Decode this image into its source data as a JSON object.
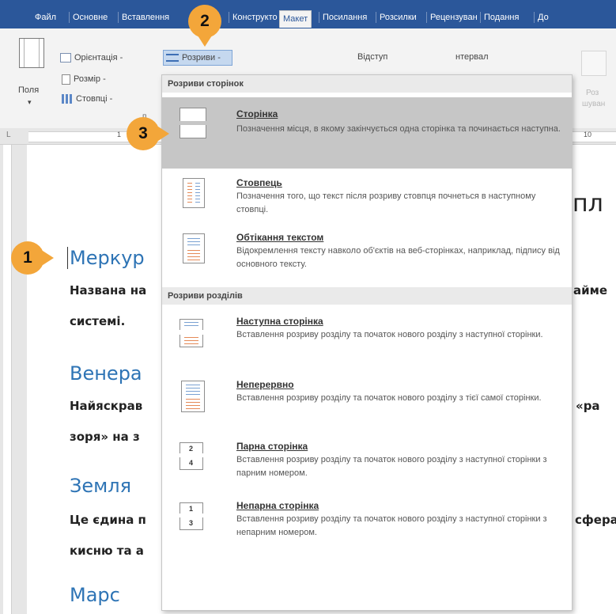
{
  "tabs": [
    "Файл",
    "Основне",
    "Вставлення",
    "Конструкто",
    "Макет",
    "Посилання",
    "Розсилки",
    "Рецензуван",
    "Подання",
    "До"
  ],
  "ribbon": {
    "margins_label": "Поля",
    "orientation_label": "Орієнтація -",
    "size_label": "Розмір -",
    "columns_label": "Стовпці -",
    "breaks_label": "Розриви -",
    "indent_label": "Відступ",
    "spacing_label": "нтервал",
    "group_label": "п",
    "right_faded_1": "Роз",
    "right_faded_2": "шуван"
  },
  "ruler": {
    "left_num": "1",
    "right_num": "10"
  },
  "document": {
    "headings": [
      "Меркур",
      "Венера",
      "Земля",
      "Марс"
    ],
    "title_fragment": "пл",
    "lines": [
      "Названа на",
      "системі.",
      "Найяскрав",
      "зоря» на з",
      "Це єдина п",
      "кисню та а"
    ],
    "right_fragments": [
      "айме",
      "«ра",
      "сфера"
    ]
  },
  "menu": {
    "section1": "Розриви сторінок",
    "section2": "Розриви розділів",
    "items": [
      {
        "title": "Сторінка",
        "desc": "Позначення місця, в якому закінчується одна сторінка та починається наступна."
      },
      {
        "title": "Стовпець",
        "desc": "Позначення того, що текст після розриву стовпця почнеться в наступному стовпці."
      },
      {
        "title": "Обтікання текстом",
        "desc": "Відокремлення тексту навколо об'єктів на веб-сторінках, наприклад, підпису від основного тексту."
      },
      {
        "title": "Наступна сторінка",
        "desc": "Вставлення розриву розділу та початок нового розділу з наступної сторінки."
      },
      {
        "title": "Неперервно",
        "desc": "Вставлення розриву розділу та початок нового розділу з тієї самої сторінки."
      },
      {
        "title": "Парна сторінка",
        "desc": "Вставлення розриву розділу та початок нового розділу з наступної сторінки з парним номером."
      },
      {
        "title": "Непарна сторінка",
        "desc": "Вставлення розриву розділу та початок нового розділу з наступної сторінки з непарним номером."
      }
    ],
    "icon_numbers": {
      "even_top": "2",
      "even_bottom": "4",
      "odd_top": "1",
      "odd_bottom": "3"
    }
  },
  "callouts": [
    "1",
    "2",
    "3"
  ],
  "colors": {
    "ribbon_blue": "#2b579a",
    "heading_blue": "#2e74b5",
    "callout_orange": "#f3a63a",
    "hover_gray": "#c6c6c6"
  }
}
